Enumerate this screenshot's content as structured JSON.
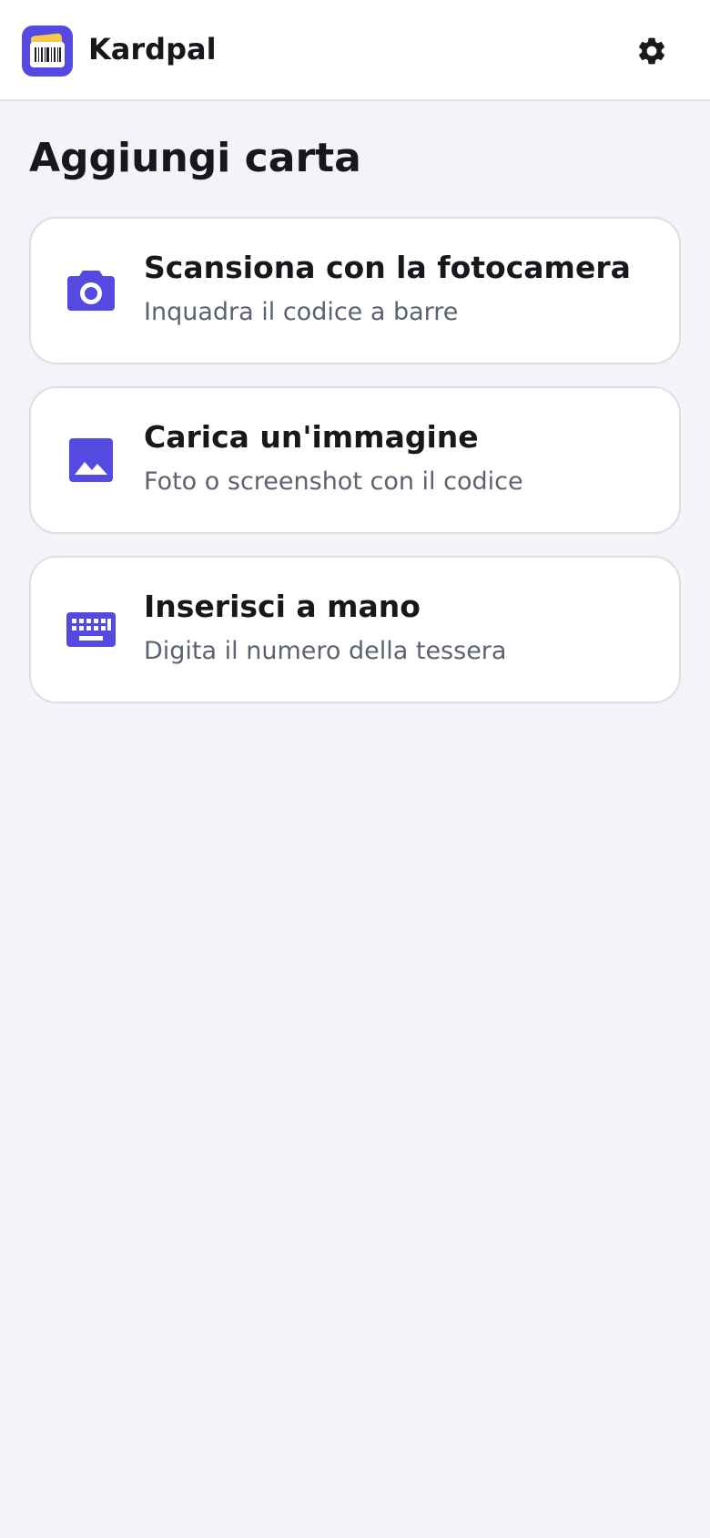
{
  "app": {
    "name": "Kardpal",
    "accent_color": "#544ae1",
    "logo_icon": "barcode-card-icon",
    "settings_icon": "gear-icon"
  },
  "page": {
    "title": "Aggiungi carta"
  },
  "options": [
    {
      "icon": "camera-icon",
      "title": "Scansiona con la fotocamera",
      "subtitle": "Inquadra il codice a barre"
    },
    {
      "icon": "image-icon",
      "title": "Carica un'immagine",
      "subtitle": "Foto o screenshot con il codice"
    },
    {
      "icon": "keyboard-icon",
      "title": "Inserisci a mano",
      "subtitle": "Digita il numero della tessera"
    }
  ]
}
